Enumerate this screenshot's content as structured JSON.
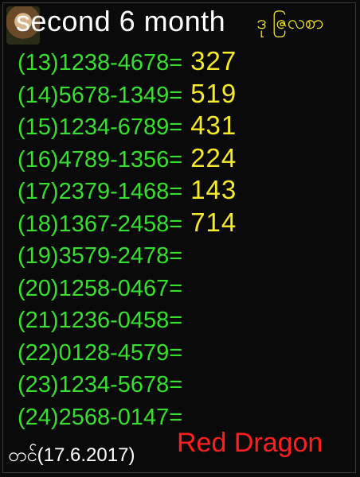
{
  "header": {
    "title": "second 6 month",
    "suffix": "ဒု ဇြလစာ"
  },
  "rows": [
    {
      "id": "(13)",
      "code": "1238-4678",
      "eq": "=",
      "result": "327"
    },
    {
      "id": "(14)",
      "code": "5678-1349",
      "eq": "=",
      "result": "519"
    },
    {
      "id": "(15)",
      "code": "1234-6789",
      "eq": "=",
      "result": "431"
    },
    {
      "id": "(16)",
      "code": "4789-1356",
      "eq": "=",
      "result": "224"
    },
    {
      "id": "(17)",
      "code": "2379-1468",
      "eq": "=",
      "result": "143"
    },
    {
      "id": "(18)",
      "code": "1367-2458",
      "eq": "=",
      "result": "714"
    },
    {
      "id": "(19)",
      "code": "3579-2478",
      "eq": "=",
      "result": ""
    },
    {
      "id": "(20)",
      "code": "1258-0467",
      "eq": "=",
      "result": ""
    },
    {
      "id": "(21)",
      "code": "1236-0458",
      "eq": "=",
      "result": ""
    },
    {
      "id": "(22)",
      "code": "0128-4579",
      "eq": "=",
      "result": ""
    },
    {
      "id": "(23)",
      "code": "1234-5678",
      "eq": "=",
      "result": ""
    },
    {
      "id": "(24)",
      "code": "2568-0147",
      "eq": "=",
      "result": ""
    }
  ],
  "footer": {
    "date": "တင်(17.6.2017)",
    "brand": "Red Dragon"
  },
  "colors": {
    "background": "#0a0a0a",
    "code_green": "#37e02f",
    "result_yellow": "#f7ea2a",
    "brand_red": "#ff1f1f",
    "title_white": "#ffffff"
  }
}
